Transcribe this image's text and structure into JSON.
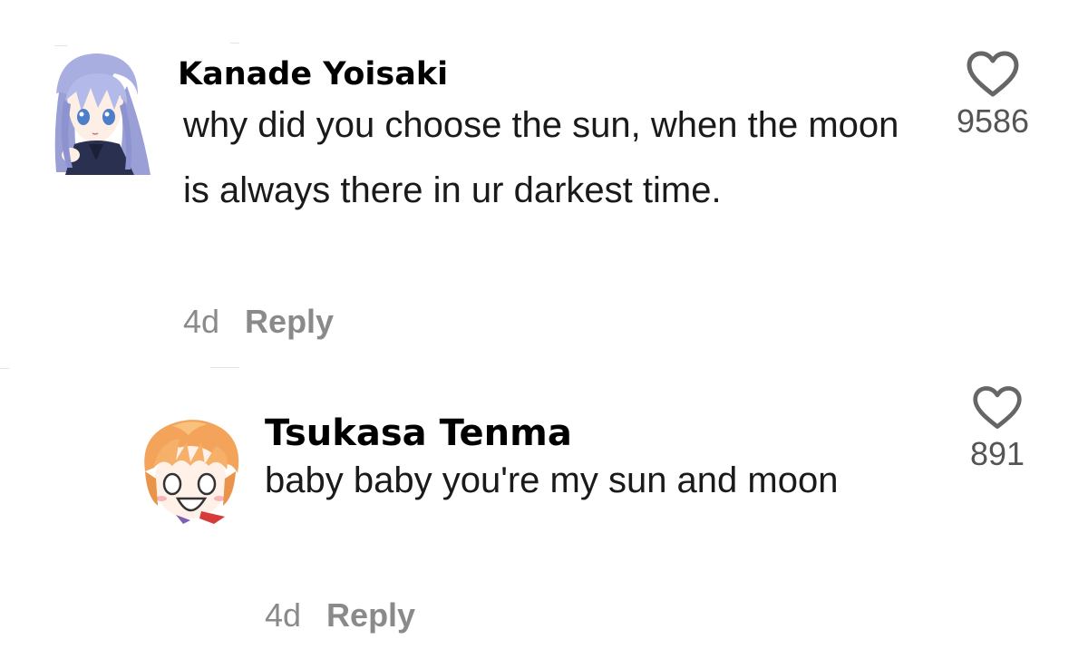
{
  "comments": [
    {
      "username": "Kanade Yoisaki",
      "text": "why did you choose the sun, when the moon is always there in ur darkest time.",
      "time": "4d",
      "reply_label": "Reply",
      "likes": "9586",
      "avatar": "kanade-avatar-icon"
    },
    {
      "username": "Tsukasa Tenma",
      "text": "baby baby you're my sun and moon",
      "time": "4d",
      "reply_label": "Reply",
      "likes": "891",
      "avatar": "tsukasa-avatar-icon"
    }
  ],
  "colors": {
    "meta": "#8a8a8a",
    "heart": "#666666",
    "kanade_hair": "#9a9fd6",
    "tsukasa_hair": "#f3a45a"
  },
  "icons": {
    "like": "heart-outline-icon"
  }
}
